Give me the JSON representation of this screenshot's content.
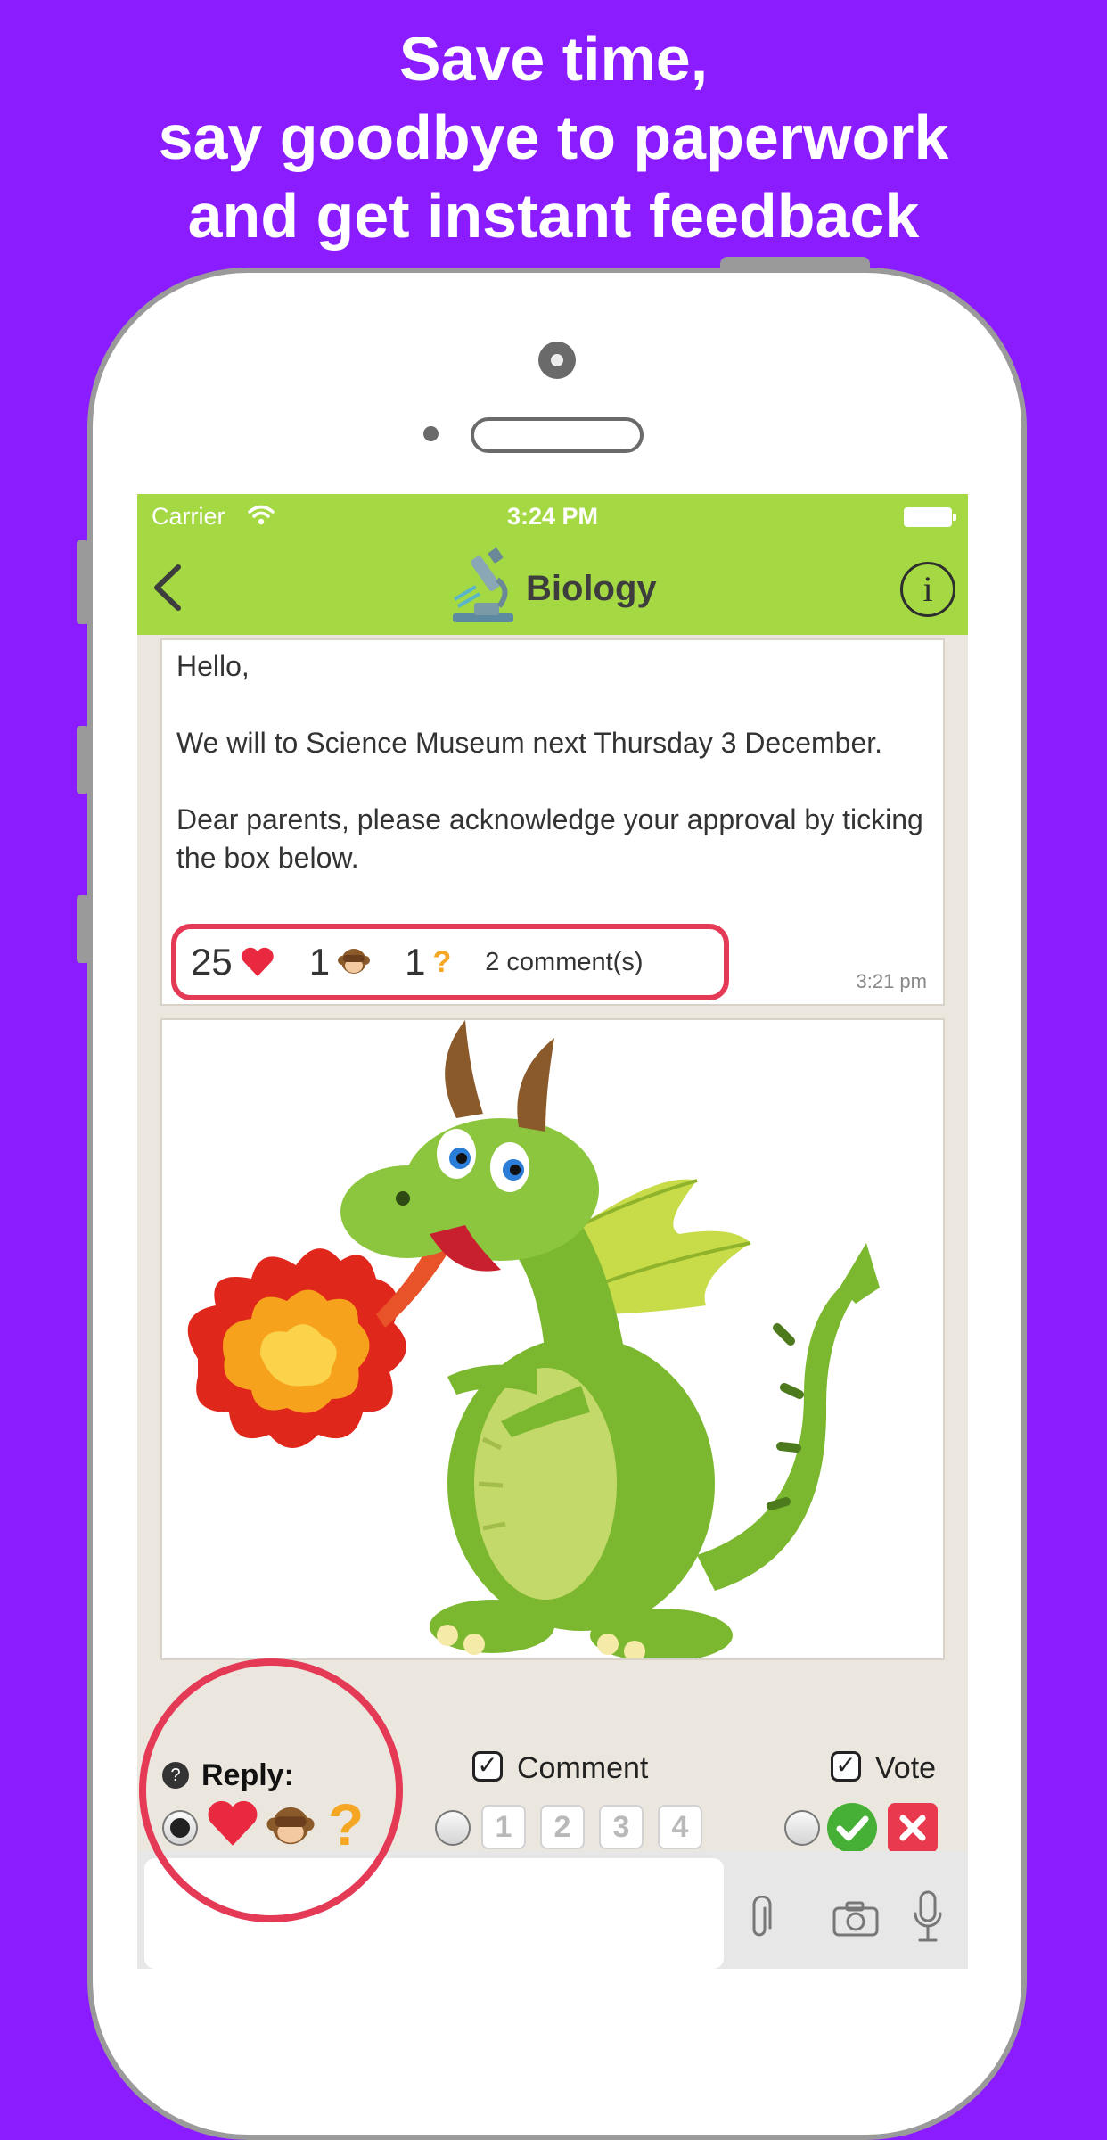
{
  "headline": {
    "line1": "Save time,",
    "line2": "say goodbye to paperwork",
    "line3": "and get instant feedback"
  },
  "colors": {
    "background": "#8a1cff",
    "app_bar": "#a5d944",
    "highlight": "#e43a56"
  },
  "status_bar": {
    "carrier": "Carrier",
    "time": "3:24 PM"
  },
  "nav": {
    "title": "Biology",
    "info_label": "i"
  },
  "message": {
    "greeting": "Hello,",
    "body1": "We will to Science Museum next Thursday 3 December.",
    "body2": "Dear parents, please acknowledge your approval by ticking the box below.",
    "time": "3:21 pm",
    "reactions": {
      "hearts": "25",
      "monkeys": "1",
      "questions": "1",
      "question_mark": "?",
      "comments": "2 comment(s)"
    }
  },
  "reply_panel": {
    "help": "?",
    "reply_label": "Reply:",
    "comment_label": "Comment",
    "vote_label": "Vote",
    "question_glyph": "?",
    "numbers": [
      "1",
      "2",
      "3",
      "4"
    ]
  },
  "input_bar": {
    "placeholder": ""
  },
  "icons": [
    "wifi-icon",
    "battery-icon",
    "back-chevron-icon",
    "microscope-icon",
    "info-icon",
    "heart-icon",
    "monkey-icon",
    "question-icon",
    "check-icon",
    "cross-icon",
    "paperclip-icon",
    "camera-icon",
    "microphone-icon"
  ]
}
